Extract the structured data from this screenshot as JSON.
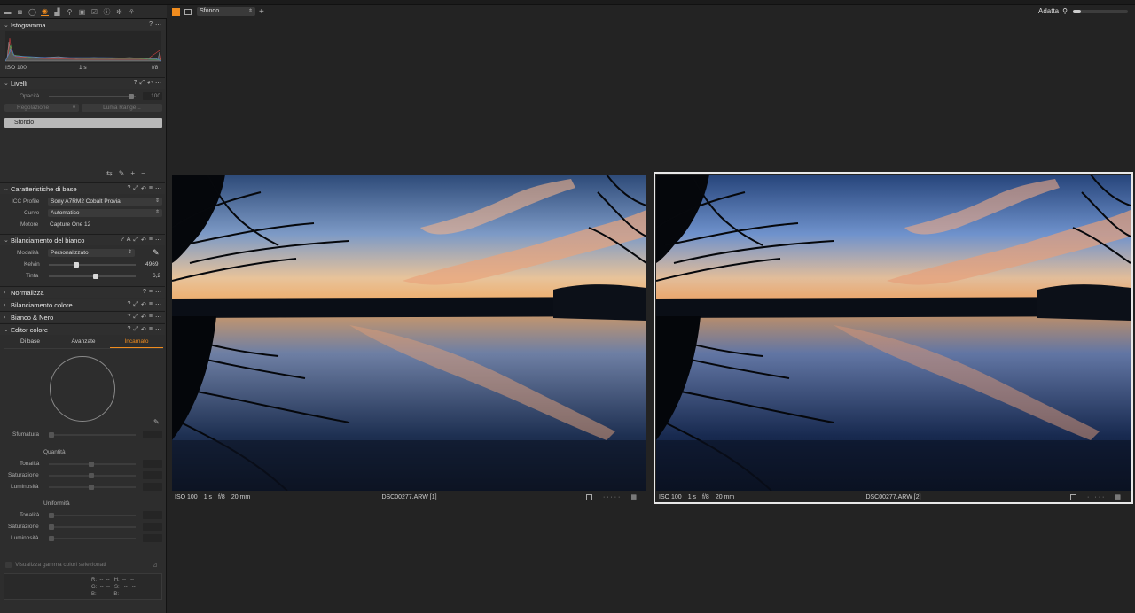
{
  "toolbar": {
    "icons": [
      "folder-icon",
      "camera-icon",
      "lens-icon",
      "color-icon",
      "exposure-icon",
      "search-icon",
      "adjust-icon",
      "checklist-icon",
      "info-icon",
      "gear-icon",
      "share-icon"
    ]
  },
  "viewer_bar": {
    "variant_select": "Sfondo",
    "zoom_label": "Adatta"
  },
  "histogram": {
    "title": "Istogramma",
    "iso": "ISO 100",
    "shutter": "1 s",
    "aperture": "f/8"
  },
  "layers": {
    "title": "Livelli",
    "opacity_label": "Opacità",
    "opacity_value": "100",
    "adjust_button": "Regolazione",
    "luma_button": "Luma Range...",
    "layer_name": "Sfondo"
  },
  "base": {
    "title": "Caratteristiche di base",
    "icc_label": "ICC Profile",
    "icc_value": "Sony A7RM2 Cobalt Provia",
    "curve_label": "Curve",
    "curve_value": "Automatico",
    "engine_label": "Motore",
    "engine_value": "Capture One 12"
  },
  "wb": {
    "title": "Bilanciamento del bianco",
    "mode_label": "Modalità",
    "mode_value": "Personalizzato",
    "kelvin_label": "Kelvin",
    "kelvin_value": "4969",
    "tint_label": "Tinta",
    "tint_value": "6,2"
  },
  "collapsed": {
    "normalize": "Normalizza",
    "color_balance": "Bilanciamento colore",
    "bw": "Bianco & Nero"
  },
  "color_editor": {
    "title": "Editor colore",
    "tabs": [
      "Di base",
      "Avanzate",
      "Incarnato"
    ],
    "smoothness_label": "Sfumatura",
    "amount_title": "Quantità",
    "uniformity_title": "Uniformità",
    "hue_label": "Tonalità",
    "sat_label": "Saturazione",
    "lum_label": "Luminosità",
    "show_gamut_label": "Visualizza gamma colori selezionati",
    "readout": {
      "r": "R:",
      "g": "G:",
      "b": "B:",
      "h": "H:",
      "s": "S:",
      "b2": "B:",
      "dash": "--"
    }
  },
  "images": [
    {
      "iso": "ISO 100",
      "shutter": "1 s",
      "aperture": "f/8",
      "focal": "20 mm",
      "filename": "DSC00277.ARW [1]"
    },
    {
      "iso": "ISO 100",
      "shutter": "1 s",
      "aperture": "f/8",
      "focal": "20 mm",
      "filename": "DSC00277.ARW [2]"
    }
  ],
  "colors": {
    "accent": "#f08c1e",
    "panel": "#2d2d2d",
    "viewer": "#232323"
  }
}
